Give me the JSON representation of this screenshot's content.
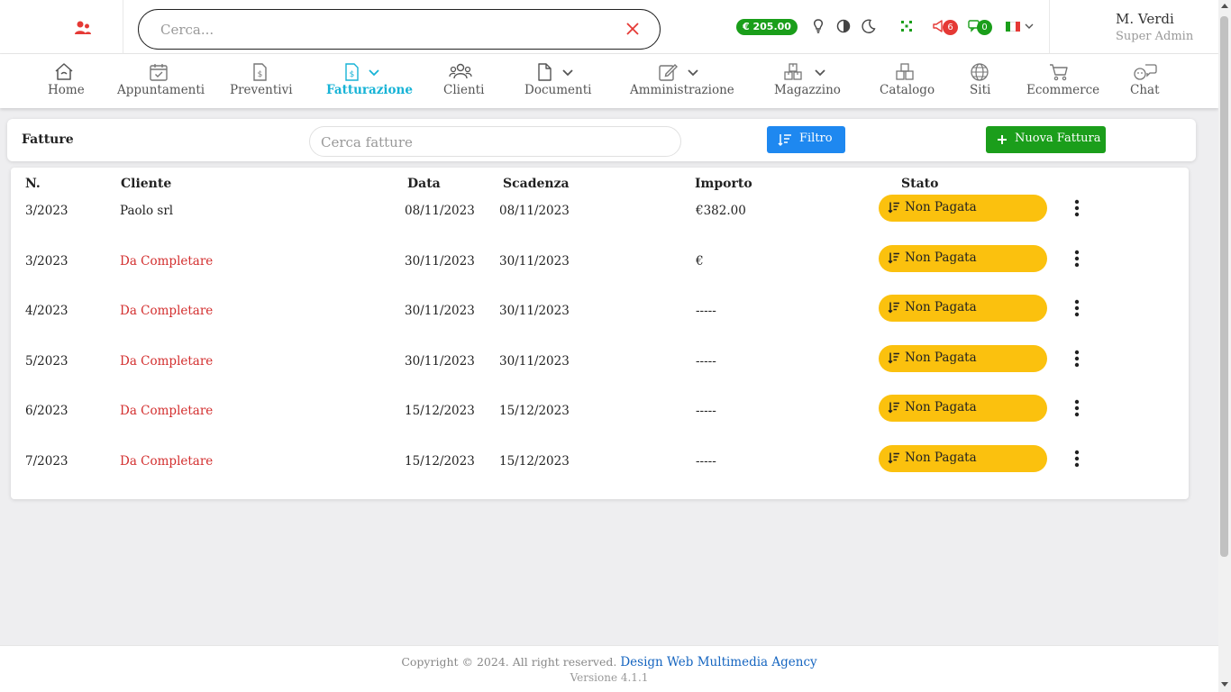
{
  "header": {
    "search_placeholder": "Cerca...",
    "credit": "€ 205.00",
    "notifications_count": "6",
    "messages_count": "0",
    "language": "it",
    "user": {
      "name": "M. Verdi",
      "role": "Super Admin"
    }
  },
  "nav": {
    "items": [
      {
        "label": "Home",
        "icon": "home-icon"
      },
      {
        "label": "Appuntamenti",
        "icon": "calendar-icon"
      },
      {
        "label": "Preventivi",
        "icon": "quote-doc-icon"
      },
      {
        "label": "Fatturazione",
        "icon": "invoice-doc-icon",
        "active": true
      },
      {
        "label": "Clienti",
        "icon": "users-icon"
      },
      {
        "label": "Documenti",
        "icon": "document-icon"
      },
      {
        "label": "Amministrazione",
        "icon": "edit-icon"
      },
      {
        "label": "Magazzino",
        "icon": "boxes-icon"
      },
      {
        "label": "Catalogo",
        "icon": "catalog-icon"
      },
      {
        "label": "Siti",
        "icon": "globe-icon"
      },
      {
        "label": "Ecommerce",
        "icon": "cart-icon"
      },
      {
        "label": "Chat",
        "icon": "chat-icon"
      }
    ]
  },
  "invoices": {
    "title": "Fatture",
    "search_placeholder": "Cerca fatture",
    "filter_label": "Filtro",
    "new_label": "Nuova Fattura",
    "columns": {
      "number": "N.",
      "client": "Cliente",
      "date": "Data",
      "due": "Scadenza",
      "amount": "Importo",
      "status": "Stato"
    },
    "rows": [
      {
        "number": "3/2023",
        "client": "Paolo srl",
        "client_incomplete": false,
        "date": "08/11/2023",
        "due": "08/11/2023",
        "amount": "€382.00",
        "status": "Non Pagata"
      },
      {
        "number": "3/2023",
        "client": "Da Completare",
        "client_incomplete": true,
        "date": "30/11/2023",
        "due": "30/11/2023",
        "amount": "€",
        "status": "Non Pagata"
      },
      {
        "number": "4/2023",
        "client": "Da Completare",
        "client_incomplete": true,
        "date": "30/11/2023",
        "due": "30/11/2023",
        "amount": "-----",
        "status": "Non Pagata"
      },
      {
        "number": "5/2023",
        "client": "Da Completare",
        "client_incomplete": true,
        "date": "30/11/2023",
        "due": "30/11/2023",
        "amount": "-----",
        "status": "Non Pagata"
      },
      {
        "number": "6/2023",
        "client": "Da Completare",
        "client_incomplete": true,
        "date": "15/12/2023",
        "due": "15/12/2023",
        "amount": "-----",
        "status": "Non Pagata"
      },
      {
        "number": "7/2023",
        "client": "Da Completare",
        "client_incomplete": true,
        "date": "15/12/2023",
        "due": "15/12/2023",
        "amount": "-----",
        "status": "Non Pagata"
      }
    ]
  },
  "footer": {
    "copyright": "Copyright © 2024. All right reserved.",
    "agency": "Design Web Multimedia Agency",
    "version": "Versione 4.1.1"
  },
  "colors": {
    "accent": "#17b3d6",
    "credit_green": "#1a9e1a",
    "filter_blue": "#1e88f0",
    "new_green": "#1b9e1b",
    "status_yellow": "#fbc10e",
    "incomplete_red": "#d32f2f"
  }
}
